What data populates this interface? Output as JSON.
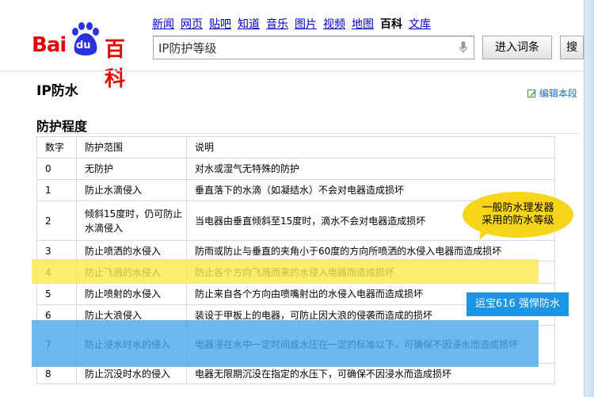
{
  "nav": {
    "items": [
      "新闻",
      "网页",
      "贴吧",
      "知道",
      "音乐",
      "图片",
      "视频",
      "地图",
      "百科",
      "文库"
    ],
    "active": "百科"
  },
  "logo": {
    "bai": "Bai",
    "du": "du",
    "baike": "百科"
  },
  "search": {
    "value": "IP防护等级",
    "placeholder": ""
  },
  "buttons": {
    "enter": "进入词条",
    "search": "搜"
  },
  "entry": {
    "title": "IP防水",
    "edit": "编辑本段"
  },
  "section": {
    "title": "防护程度"
  },
  "table": {
    "headers": [
      "数字",
      "防护范围",
      "说明"
    ],
    "rows": [
      {
        "num": "0",
        "scope": "无防护",
        "desc": "对水或湿气无特殊的防护"
      },
      {
        "num": "1",
        "scope": "防止水滴侵入",
        "desc": "垂直落下的水滴（如凝结水）不会对电器造成损坏"
      },
      {
        "num": "2",
        "scope": "倾斜15度时，仍可防止水滴侵入",
        "desc": "当电器由垂直倾斜至15度时，滴水不会对电器造成损坏"
      },
      {
        "num": "3",
        "scope": "防止喷洒的水侵入",
        "desc": "防雨或防止与垂直的夹角小于60度的方向所喷洒的水侵入电器而造成损坏"
      },
      {
        "num": "4",
        "scope": "防止飞溅的水侵入",
        "desc": "防止各个方向飞溅而来的水侵入电器而造成损坏"
      },
      {
        "num": "5",
        "scope": "防止喷射的水侵入",
        "desc": "防止来自各个方向由喷嘴射出的水侵入电器而造成损坏"
      },
      {
        "num": "6",
        "scope": "防止大浪侵入",
        "desc": "装设于甲板上的电器，可防止因大浪的侵袭而造成的损坏"
      },
      {
        "num": "7",
        "scope": "防止浸水时水的侵入",
        "desc": "电器浸在水中一定时间或水压在一定的标准以下，可确保不因浸水而造成损坏"
      },
      {
        "num": "8",
        "scope": "防止沉没时水的侵入",
        "desc": "电器无限期沉没在指定的水压下，可确保不因浸水而造成损坏"
      }
    ]
  },
  "annotations": {
    "yellow_bubble_line1": "一般防水理发器",
    "yellow_bubble_line2": "采用的防水等级",
    "blue_label": "运宝616 强悍防水"
  },
  "colors": {
    "brand_red": "#e10602",
    "brand_blue": "#2932e1",
    "highlight_yellow": "#fae848",
    "highlight_blue": "#46a8eb",
    "link": "#0000cc"
  }
}
